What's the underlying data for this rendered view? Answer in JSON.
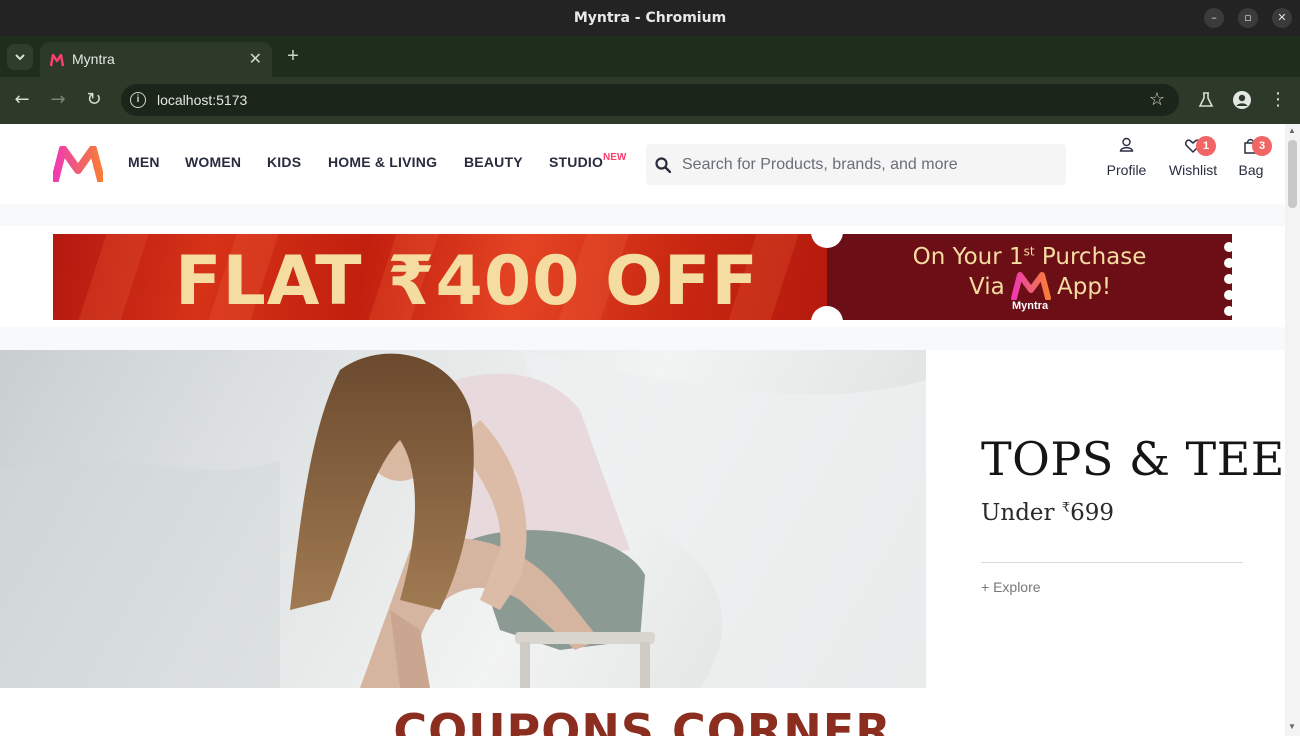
{
  "window": {
    "title": "Myntra - Chromium"
  },
  "browser": {
    "tab_title": "Myntra",
    "url": "localhost:5173"
  },
  "header": {
    "nav": {
      "men": "MEN",
      "women": "WOMEN",
      "kids": "KIDS",
      "home_living": "HOME & LIVING",
      "beauty": "BEAUTY",
      "studio": "STUDIO",
      "studio_badge": "NEW"
    },
    "search_placeholder": "Search for Products, brands, and more",
    "profile_label": "Profile",
    "wishlist_label": "Wishlist",
    "wishlist_count": "1",
    "bag_label": "Bag",
    "bag_count": "3"
  },
  "promo": {
    "headline": "FLAT ₹400 OFF",
    "line1": "On Your 1",
    "line1_sup": "st",
    "line1_rest": " Purchase",
    "via": "Via",
    "app": "App!",
    "logo_caption": "Myntra"
  },
  "hero": {
    "title": "TOPS & TEES",
    "subtitle_prefix": "Under ",
    "currency": "₹",
    "price": "699",
    "explore": "+ Explore"
  },
  "sections": {
    "coupons_title": "COUPONS CORNER"
  },
  "colors": {
    "brand_pink": "#ff3f6c",
    "badge_red": "#f16565",
    "text_dark": "#282c3f",
    "promo_cream": "#f5dca0",
    "promo_maroon": "#6b0e16",
    "coupons_brown": "#8b2d1f"
  }
}
